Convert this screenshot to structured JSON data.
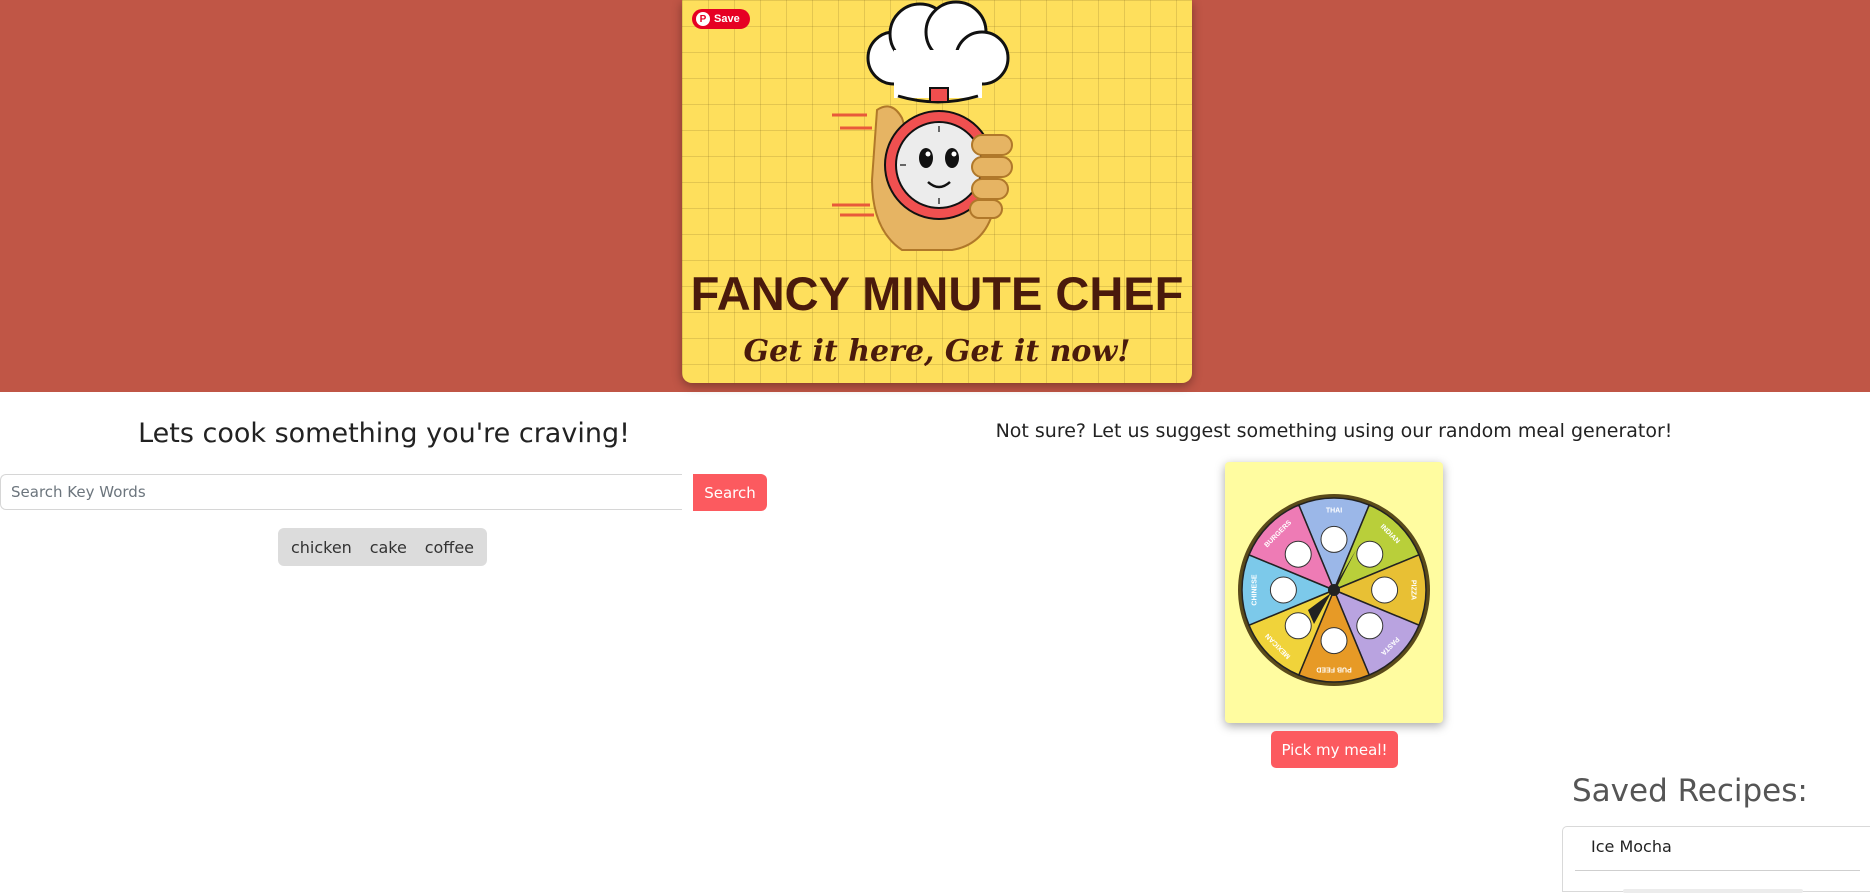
{
  "header": {
    "pin_save_label": "Save",
    "brand_title": "FANCY MINUTE CHEF",
    "brand_tagline": "Get it here, Get it now!"
  },
  "search": {
    "heading": "Lets cook something you're craving!",
    "placeholder": "Search Key Words",
    "value": "",
    "button_label": "Search",
    "suggestions": [
      "chicken",
      "cake",
      "coffee"
    ]
  },
  "random": {
    "heading": "Not sure? Let us suggest something using our random meal generator!",
    "wheel_segments": [
      "THAI",
      "INDIAN",
      "PIZZA",
      "PASTA",
      "PUB FEED",
      "MEXICAN",
      "CHINESE",
      "BURGERS"
    ],
    "button_label": "Pick my meal!"
  },
  "saved": {
    "title": "Saved Recipes:",
    "items": [
      "Ice Mocha"
    ]
  },
  "colors": {
    "header_bg": "#c05646",
    "accent": "#fc5a5f",
    "logo_bg": "#fedf5c",
    "wheel_bg": "#fffca0",
    "brand_text": "#4a1a0c"
  }
}
